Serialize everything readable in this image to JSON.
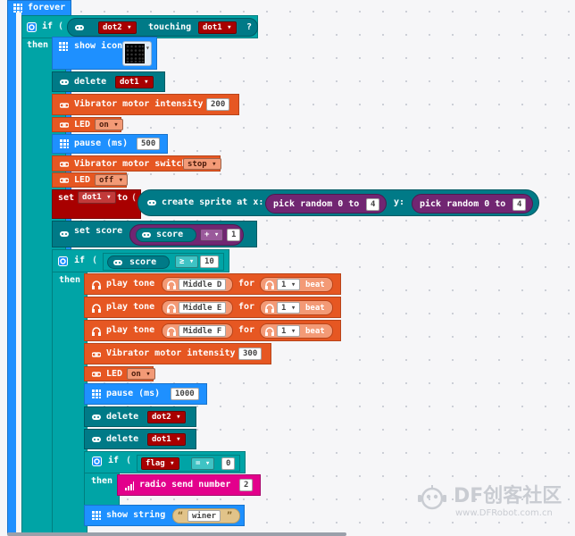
{
  "colors": {
    "basic": "#1e90ff",
    "sprite": "#007a87",
    "music": "#e65722",
    "logic": "#00a4a6",
    "variable": "#a80000",
    "radio": "#e3008c",
    "math": "#712672",
    "text": "#e1c389",
    "forever": "#1e90ff"
  },
  "forever": {
    "label": "forever"
  },
  "if1": {
    "if_label": "if",
    "then_label": "then",
    "cond_var1": "dot2",
    "touching_label": "touching",
    "cond_var2": "dot1",
    "question": "?"
  },
  "show_icon": {
    "label": "show icon"
  },
  "delete1": {
    "label": "delete",
    "var": "dot1"
  },
  "vib1": {
    "label": "Vibrator motor intensity",
    "value": "200"
  },
  "led1": {
    "label": "LED",
    "value": "on"
  },
  "pause1": {
    "label": "pause (ms)",
    "value": "500"
  },
  "vibswitch": {
    "label": "Vibrator motor switch",
    "value": "stop"
  },
  "led2": {
    "label": "LED",
    "value": "off"
  },
  "setdot": {
    "set_label": "set",
    "var": "dot1",
    "to_label": "to",
    "create_label": "create sprite at x:",
    "pick1_label": "pick random 0 to",
    "pick1_value": "4",
    "y_label": "y:",
    "pick2_label": "pick random 0 to",
    "pick2_value": "4"
  },
  "setscore": {
    "label": "set score",
    "score_label": "score",
    "op": "+",
    "value": "1"
  },
  "if2": {
    "if_label": "if",
    "then_label": "then",
    "score_label": "score",
    "op": "≥",
    "value": "10"
  },
  "tone1": {
    "play": "play tone",
    "note": "Middle D",
    "for": "for",
    "beats": "1",
    "beat": "beat"
  },
  "tone2": {
    "play": "play tone",
    "note": "Middle E",
    "for": "for",
    "beats": "1",
    "beat": "beat"
  },
  "tone3": {
    "play": "play tone",
    "note": "Middle F",
    "for": "for",
    "beats": "1",
    "beat": "beat"
  },
  "vib2": {
    "label": "Vibrator motor intensity",
    "value": "300"
  },
  "led3": {
    "label": "LED",
    "value": "on"
  },
  "pause2": {
    "label": "pause (ms)",
    "value": "1000"
  },
  "delete2": {
    "label": "delete",
    "var": "dot2"
  },
  "delete3": {
    "label": "delete",
    "var": "dot1"
  },
  "if3": {
    "if_label": "if",
    "then_label": "then",
    "var": "flag",
    "op": "=",
    "value": "0"
  },
  "radio": {
    "label": "radio send number",
    "value": "2"
  },
  "showstring": {
    "label": "show string",
    "value": "winer"
  },
  "watermark": {
    "brand": "DF创客社区",
    "url": "www.DFRobot.com.cn"
  }
}
